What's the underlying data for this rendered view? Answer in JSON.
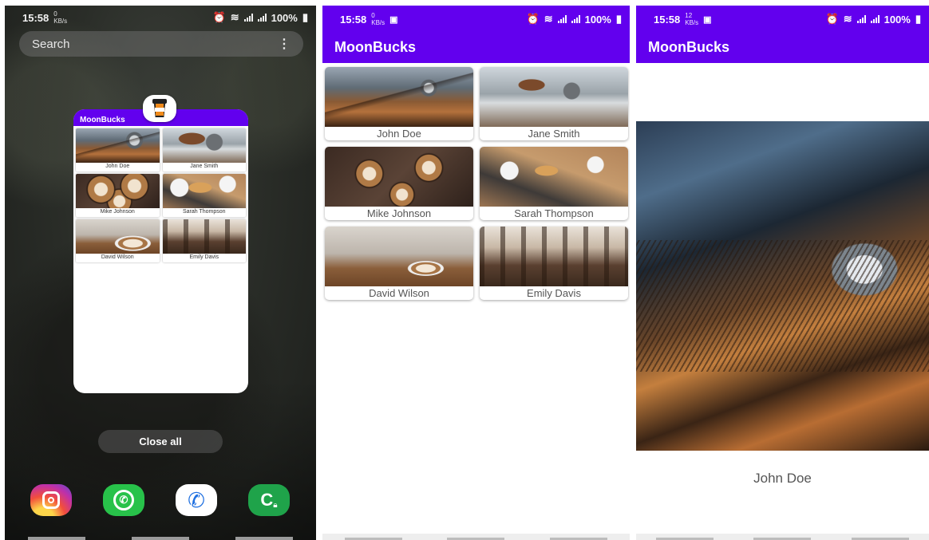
{
  "app_name": "MoonBucks",
  "colors": {
    "primary": "#6200ee"
  },
  "recents": {
    "status": {
      "time": "15:58",
      "speed": "0",
      "speed_unit": "KB/s",
      "battery": "100%"
    },
    "search_placeholder": "Search",
    "card_title": "MoonBucks",
    "close_all": "Close all",
    "dock_icons": [
      "instagram-icon",
      "whatsapp-icon",
      "phone-icon",
      "secure-call-icon"
    ]
  },
  "list_screen": {
    "status": {
      "time": "15:58",
      "speed": "0",
      "speed_unit": "KB/s",
      "battery": "100%"
    },
    "title": "MoonBucks",
    "items": [
      {
        "name": "John Doe"
      },
      {
        "name": "Jane Smith"
      },
      {
        "name": "Mike Johnson"
      },
      {
        "name": "Sarah Thompson"
      },
      {
        "name": "David Wilson"
      },
      {
        "name": "Emily Davis"
      }
    ]
  },
  "detail_screen": {
    "status": {
      "time": "15:58",
      "speed": "12",
      "speed_unit": "KB/s",
      "battery": "100%"
    },
    "title": "MoonBucks",
    "name": "John Doe"
  }
}
